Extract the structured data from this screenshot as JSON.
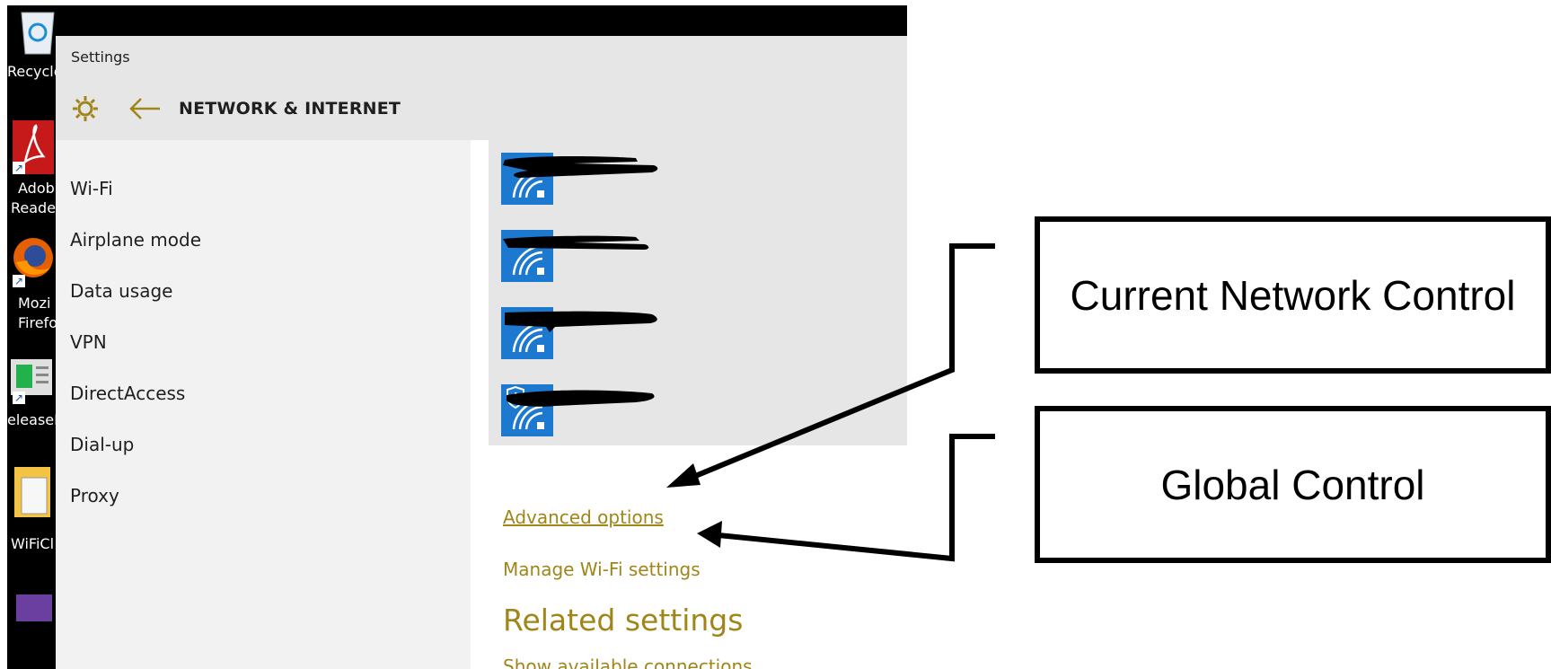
{
  "desktop": {
    "icons": [
      {
        "name": "recycle-bin",
        "label": "Recycle"
      },
      {
        "name": "adobe-reader",
        "label": "Adob",
        "label2": "Reader"
      },
      {
        "name": "mozilla-firefox",
        "label": "Mozi",
        "label2": "Firefo"
      },
      {
        "name": "release-notes",
        "label": "eleaseN"
      },
      {
        "name": "wificl",
        "label": "WiFiCl"
      }
    ]
  },
  "window": {
    "title": "Settings",
    "page_title": "NETWORK & INTERNET",
    "accent_color": "#a08518",
    "tile_color": "#1d79cf"
  },
  "nav": {
    "items": [
      "Wi-Fi",
      "Airplane mode",
      "Data usage",
      "VPN",
      "DirectAccess",
      "Dial-up",
      "Proxy"
    ]
  },
  "networks": [
    {
      "secured": false
    },
    {
      "secured": false
    },
    {
      "secured": false
    },
    {
      "secured": true
    }
  ],
  "links": {
    "advanced_options": "Advanced options",
    "manage_wifi": "Manage Wi-Fi settings",
    "related_heading": "Related settings",
    "show_connections": "Show available connections"
  },
  "annotations": {
    "current_network_control": "Current Network Control",
    "global_control": "Global Control"
  }
}
